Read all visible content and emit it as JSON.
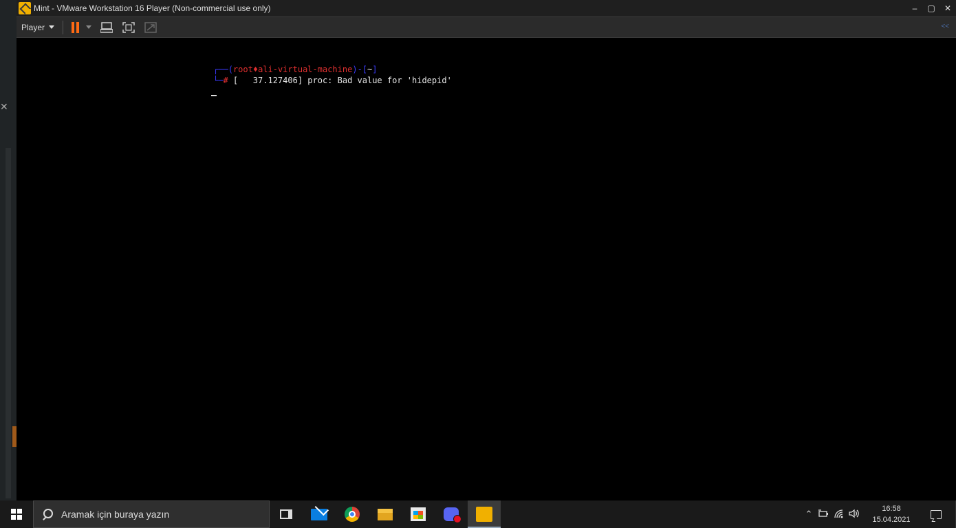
{
  "window": {
    "title": "Mint - VMware Workstation 16 Player (Non-commercial use only)",
    "controls": {
      "minimize": "–",
      "maximize": "▢",
      "close": "✕"
    }
  },
  "toolbar": {
    "player_label": "Player",
    "collapse_glyph": "<<"
  },
  "terminal": {
    "prompt_corner": "┌──",
    "prompt_open": "(",
    "prompt_user": "root",
    "prompt_at": "♦",
    "prompt_host": "ali-virtual-machine",
    "prompt_close": ")-[",
    "prompt_dir": "~",
    "prompt_end": "]",
    "prompt2_corner": "└─",
    "prompt_symbol": "#",
    "kernel_message": " [   37.127406] proc: Bad value for 'hidepid'"
  },
  "taskbar": {
    "search_placeholder": "Aramak için buraya yazın",
    "clock_time": "16:58",
    "clock_date": "15.04.2021",
    "items": [
      "task-view",
      "mail",
      "chrome",
      "file-explorer",
      "microsoft-store",
      "discord",
      "vmware-player"
    ]
  },
  "colors": {
    "accent_pause": "#ff6a13",
    "terminal_blue": "#3b3bff",
    "terminal_red": "#e03030"
  }
}
